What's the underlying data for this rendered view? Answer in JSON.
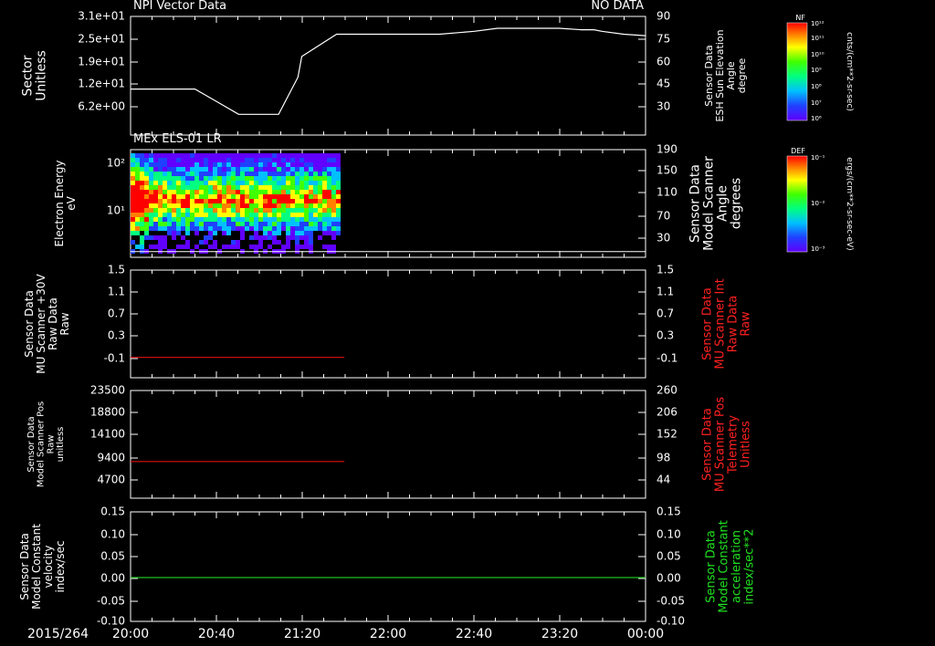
{
  "chart_data": [
    {
      "type": "line",
      "title": "NPI Vector Data",
      "status": "NO DATA",
      "left_axis": {
        "label_lines": [
          "Sector",
          "Unitless"
        ],
        "ticks": [
          "3.1e+01",
          "2.5e+01",
          "1.9e+01",
          "1.2e+01",
          "6.2e+00"
        ],
        "range": [
          0,
          31
        ]
      },
      "right_axis": {
        "label_lines": [
          "Sensor Data",
          "ESH Sun Elevation",
          "Angle",
          "degree"
        ],
        "ticks": [
          "90",
          "75",
          "60",
          "45",
          "30"
        ],
        "range": [
          10,
          90
        ]
      },
      "series": [
        {
          "color": "#ffffff",
          "x_hours": [
            0,
            0.5,
            0.66,
            0.84,
            1.15,
            1.3,
            1.33,
            1.6,
            2.35,
            2.4,
            2.67,
            2.85,
            3.0,
            3.33,
            3.5,
            3.6,
            3.66,
            3.83,
            4.0
          ],
          "values": [
            41,
            41,
            33,
            24,
            24,
            49,
            63,
            78,
            78,
            78,
            80,
            82,
            82,
            82,
            81,
            81,
            80,
            78,
            77
          ]
        }
      ]
    },
    {
      "type": "heatmap",
      "title": "MEx ELS-01 LR",
      "left_axis": {
        "label_lines": [
          "Electron Energy",
          "eV"
        ],
        "scale": "log",
        "ticks": [
          "10²",
          "10¹"
        ]
      },
      "right_axis": {
        "label_lines": [
          "Sensor Data",
          "Model Scanner",
          "Angle",
          "degrees"
        ],
        "ticks": [
          "190",
          "150",
          "110",
          "70",
          "30"
        ],
        "range": [
          0,
          190
        ]
      },
      "colorbar": {
        "label": "DEF",
        "unit": "ergs/(cm**2-sr-sec-eV)",
        "ticks": [
          "10⁻¹",
          "10⁻²",
          "10⁻³"
        ]
      },
      "data_extent_hours": [
        0,
        1.6
      ],
      "angle_line_deg": 10
    },
    {
      "type": "line",
      "left_axis": {
        "label_lines": [
          "Sensor Data",
          "MU Scanner +30V",
          "Raw Data",
          "Raw"
        ],
        "ticks": [
          "1.5",
          "1.1",
          "0.7",
          "0.3",
          "-0.1"
        ],
        "range": [
          -0.35,
          1.5
        ]
      },
      "right_axis": {
        "label_lines": [
          "Sensor Data",
          "MU Scanner Int",
          "Raw Data",
          "Raw"
        ],
        "ticks": [
          "1.5",
          "1.1",
          "0.7",
          "0.3",
          "-0.1"
        ],
        "color": "#ff2020"
      },
      "series": [
        {
          "color": "#e01010",
          "x_hours": [
            0,
            1.66
          ],
          "values": [
            0,
            0
          ]
        }
      ]
    },
    {
      "type": "line",
      "left_axis": {
        "label_lines": [
          "Sensor Data",
          "Model Scanner Pos",
          "Raw",
          "unitless"
        ],
        "ticks": [
          "23500",
          "18800",
          "14100",
          "9400",
          "4700"
        ],
        "range": [
          0,
          23500
        ]
      },
      "right_axis": {
        "label_lines": [
          "Sensor Data",
          "MU Scanner Pos",
          "Telemetry",
          "Unitless"
        ],
        "ticks": [
          "260",
          "206",
          "152",
          "98",
          "44"
        ],
        "color": "#ff2020"
      },
      "series": [
        {
          "color": "#e01010",
          "x_hours": [
            0,
            1.66
          ],
          "values": [
            8000,
            8000
          ]
        }
      ]
    },
    {
      "type": "line",
      "left_axis": {
        "label_lines": [
          "Sensor Data",
          "Model Constant",
          "velocity",
          "index/sec"
        ],
        "ticks": [
          "0.15",
          "0.10",
          "0.05",
          "0.00",
          "-0.05",
          "-0.10"
        ],
        "range": [
          -0.1,
          0.15
        ]
      },
      "right_axis": {
        "label_lines": [
          "Sensor Data",
          "Model Constant",
          "acceleration",
          "index/sec**2"
        ],
        "ticks": [
          "0.15",
          "0.10",
          "0.05",
          "0.00",
          "-0.05",
          "-0.10"
        ],
        "color": "#20e020"
      },
      "series": [
        {
          "color": "#20c020",
          "x_hours": [
            0,
            4
          ],
          "values": [
            0,
            0
          ]
        }
      ]
    }
  ],
  "colorbar_nf": {
    "label": "NF",
    "unit": "cnts/(cm**2-sr-sec)",
    "ticks": [
      "10¹²",
      "10¹¹",
      "10¹⁰",
      "10⁹",
      "10⁸",
      "10⁷",
      "10⁶"
    ]
  },
  "x_axis": {
    "date_label": "2015/264",
    "ticks": [
      "20:00",
      "20:40",
      "21:20",
      "22:00",
      "22:40",
      "23:20",
      "00:00"
    ]
  }
}
